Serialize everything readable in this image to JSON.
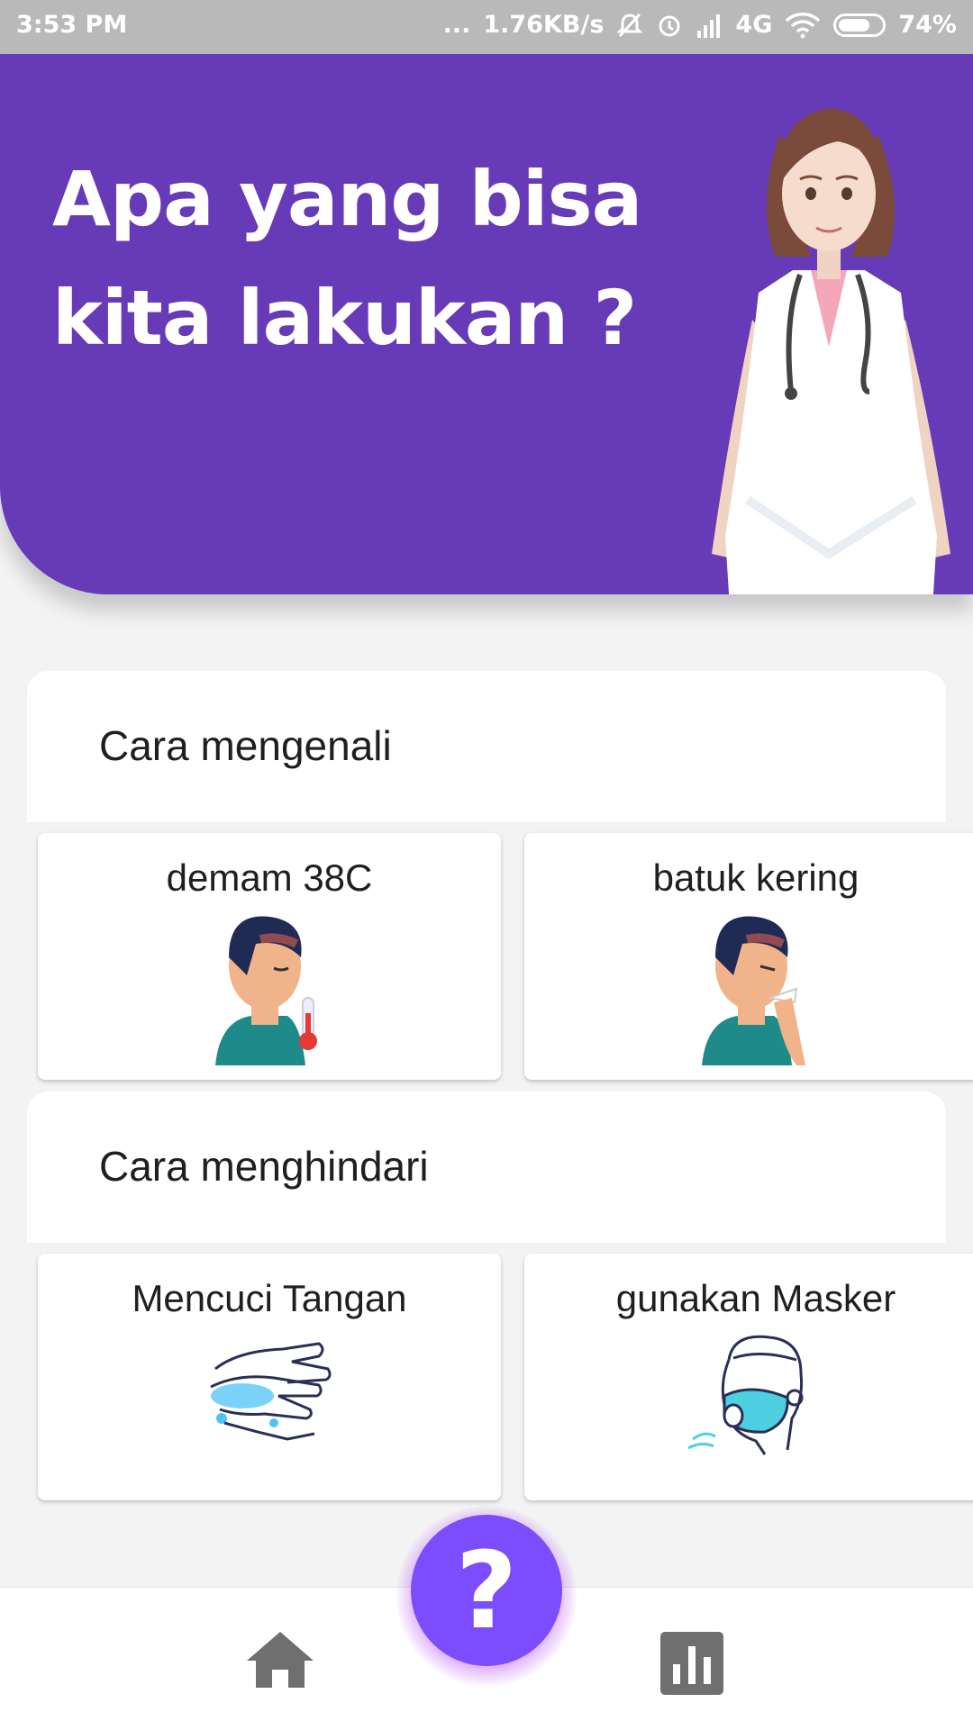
{
  "status_bar": {
    "time": "3:53 PM",
    "dots": "...",
    "speed": "1.76KB/s",
    "network": "4G",
    "battery": "74%",
    "battery_level": 0.74
  },
  "hero": {
    "title_line1": "Apa yang bisa",
    "title_line2": "kita lakukan ?"
  },
  "sections": [
    {
      "title": "Cara mengenali",
      "tiles": [
        {
          "label": "demam 38C",
          "icon": "fever-person-icon"
        },
        {
          "label": "batuk kering",
          "icon": "coughing-person-icon"
        }
      ]
    },
    {
      "title": "Cara menghindari",
      "tiles": [
        {
          "label": "Mencuci Tangan",
          "icon": "hand-washing-icon"
        },
        {
          "label": "gunakan Masker",
          "icon": "face-mask-icon"
        }
      ]
    }
  ],
  "fab": {
    "label": "?"
  },
  "nav": {
    "home_icon": "home-icon",
    "stats_icon": "bar-chart-icon"
  },
  "colors": {
    "primary": "#673ab7",
    "fab": "#7c4dff",
    "background": "#f3f3f3"
  }
}
